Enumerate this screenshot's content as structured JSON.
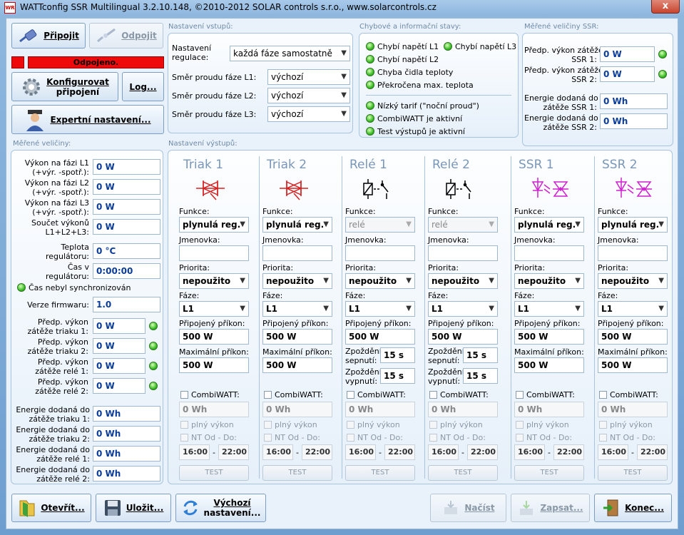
{
  "window": {
    "title": "WATTconfig SSR Multilingual 3.2.10.148, ©2010-2012 SOLAR controls s.r.o., www.solarcontrols.cz",
    "icon_text": "WR",
    "close": "x"
  },
  "connection": {
    "connect": "Připojit",
    "disconnect": "Odpojit",
    "status": "Odpojeno.",
    "configure": "Konfigurovat připojení",
    "configure_l1": "Konfigurovat",
    "configure_l2": "připojení",
    "log": "Log...",
    "expert": "Expertní nastavení..."
  },
  "inputs": {
    "group_label": "Nastavení vstupů:",
    "regulation_label_1": "Nastavení",
    "regulation_label_2": "regulace:",
    "regulation_value": "každá fáze samostatně",
    "phase_rows": [
      {
        "label": "Směr proudu fáze L1:",
        "value": "výchozí"
      },
      {
        "label": "Směr proudu fáze L2:",
        "value": "výchozí"
      },
      {
        "label": "Směr proudu fáze L3:",
        "value": "výchozí"
      }
    ]
  },
  "status": {
    "group_label": "Chybové a informační stavy:",
    "items": [
      "Chybí napětí L1",
      "Chybí napětí L3",
      "Chybí napětí L2",
      "Chyba čidla teploty",
      "Překročena max. teplota"
    ],
    "info": [
      "Nízký tarif (\"noční proud\")",
      "CombiWATT je aktivní",
      "Test výstupů je aktivní"
    ],
    "led_color": "#3cbd26"
  },
  "ssr_meas": {
    "group_label": "Měřené veličiny SSR:",
    "rows": [
      {
        "l1": "Předp. výkon zátěže",
        "l2": "SSR 1:",
        "value": "0 W"
      },
      {
        "l1": "Předp. výkon zátěže",
        "l2": "SSR 2:",
        "value": "0 W"
      },
      {
        "l1": "Energie dodaná do",
        "l2": "zátěže SSR 1:",
        "value": "0 Wh"
      },
      {
        "l1": "Energie dodaná do",
        "l2": "zátěže SSR 2:",
        "value": "0 Wh"
      }
    ]
  },
  "measured": {
    "group_label": "Měřené veličiny:",
    "rows": [
      {
        "l1": "Výkon na fázi L1",
        "l2": "(+výr. -spotř.):",
        "value": "0 W"
      },
      {
        "l1": "Výkon na fázi L2",
        "l2": "(+výr. -spotř.):",
        "value": "0 W"
      },
      {
        "l1": "Výkon na fázi L3",
        "l2": "(+výr. -spotř.):",
        "value": "0 W"
      },
      {
        "l1": "Součet výkonů",
        "l2": "L1+L2+L3:",
        "value": "0 W"
      },
      {
        "l1": "Teplota",
        "l2": "regulátoru:",
        "value": "0 °C"
      },
      {
        "l1": "Čas v",
        "l2": "regulátoru:",
        "value": "0:00:00"
      }
    ],
    "time_sync": "Čas nebyl synchronizován",
    "fw_label": "Verze firmwaru:",
    "fw_value": "1.0",
    "load_rows": [
      {
        "l1": "Předp. výkon",
        "l2": "zátěže triaku 1:",
        "value": "0 W"
      },
      {
        "l1": "Předp. výkon",
        "l2": "zátěže triaku 2:",
        "value": "0 W"
      },
      {
        "l1": "Předp. výkon",
        "l2": "zátěže relé 1:",
        "value": "0 W"
      },
      {
        "l1": "Předp. výkon",
        "l2": "zátěže relé 2:",
        "value": "0 W"
      }
    ],
    "energy_rows": [
      {
        "l1": "Energie dodaná do",
        "l2": "zátěže triaku 1:",
        "value": "0 Wh"
      },
      {
        "l1": "Energie dodaná do",
        "l2": "zátěže triaku 2:",
        "value": "0 Wh"
      },
      {
        "l1": "Energie dodaná do",
        "l2": "zátěže relé 1:",
        "value": "0 Wh"
      },
      {
        "l1": "Energie dodaná do",
        "l2": "zátěže relé 2:",
        "value": "0 Wh"
      }
    ]
  },
  "outputs": {
    "group_label": "Nastavení výstupů:",
    "labels": {
      "funkce": "Funkce:",
      "jmenovka": "Jmenovka:",
      "priorita": "Priorita:",
      "faze": "Fáze:",
      "prikon": "Připojený příkon:",
      "max": "Maximální příkon:",
      "zpozd_s1": "Zpoždění",
      "zpozd_s2": "sepnutí:",
      "zpozd_v1": "Zpoždění",
      "zpozd_v2": "vypnutí:",
      "combi": "CombiWATT:",
      "plny": "plný výkon",
      "nt": "NT Od - Do:",
      "test": "TEST",
      "dash": "-"
    },
    "columns": [
      {
        "title": "Triak 1",
        "kind": "triac",
        "funkce": "plynulá reg.",
        "priorita": "nepoužito",
        "faze": "L1",
        "prikon": "500 W",
        "max": "500 W",
        "combi_val": "0 Wh",
        "nt_from": "16:00",
        "nt_to": "22:00",
        "icon": "triac-icon"
      },
      {
        "title": "Triak 2",
        "kind": "triac",
        "funkce": "plynulá reg.",
        "priorita": "nepoužito",
        "faze": "L1",
        "prikon": "500 W",
        "max": "500 W",
        "combi_val": "0 Wh",
        "nt_from": "16:00",
        "nt_to": "22:00",
        "icon": "triac-icon"
      },
      {
        "title": "Relé 1",
        "kind": "relay",
        "funkce": "relé",
        "priorita": "nepoužito",
        "faze": "L1",
        "prikon": "500 W",
        "sepnuti": "15 s",
        "vypnuti": "15 s",
        "combi_val": "0 Wh",
        "nt_from": "16:00",
        "nt_to": "22:00",
        "icon": "relay-icon"
      },
      {
        "title": "Relé 2",
        "kind": "relay",
        "funkce": "relé",
        "priorita": "nepoužito",
        "faze": "L1",
        "prikon": "500 W",
        "sepnuti": "15 s",
        "vypnuti": "15 s",
        "combi_val": "0 Wh",
        "nt_from": "16:00",
        "nt_to": "22:00",
        "icon": "relay-icon"
      },
      {
        "title": "SSR 1",
        "kind": "ssr",
        "funkce": "plynulá reg.",
        "priorita": "nepoužito",
        "faze": "L1",
        "prikon": "500 W",
        "max": "500 W",
        "combi_val": "0 Wh",
        "nt_from": "16:00",
        "nt_to": "22:00",
        "icon": "ssr-icon"
      },
      {
        "title": "SSR 2",
        "kind": "ssr",
        "funkce": "plynulá reg.",
        "priorita": "nepoužito",
        "faze": "L1",
        "prikon": "500 W",
        "max": "500 W",
        "combi_val": "0 Wh",
        "nt_from": "16:00",
        "nt_to": "22:00",
        "icon": "ssr-icon"
      }
    ]
  },
  "footer": {
    "open": "Otevřít...",
    "save": "Uložit...",
    "defaults_l1": "Výchozí",
    "defaults_l2": "nastavení...",
    "load": "Načíst",
    "write": "Zapsat...",
    "end": "Konec..."
  },
  "colors": {
    "accent_value": "#0a3c9c",
    "status_red": "#ee0a0a",
    "triac_icon": "#d42020",
    "ssr_icon": "#d020d0"
  }
}
